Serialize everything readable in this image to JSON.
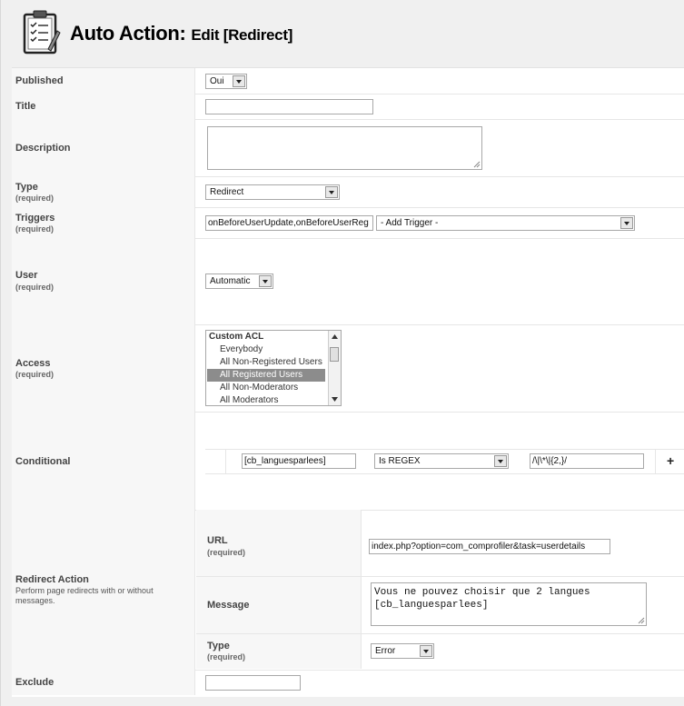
{
  "header": {
    "title_main": "Auto Action:",
    "title_sub": "Edit [Redirect]",
    "logo_icon": "notepad-checklist-icon"
  },
  "fields": {
    "published": {
      "label": "Published",
      "value": "Oui"
    },
    "title": {
      "label": "Title",
      "value": ""
    },
    "description": {
      "label": "Description",
      "value": ""
    },
    "type": {
      "label": "Type",
      "required": "(required)",
      "value": "Redirect"
    },
    "triggers": {
      "label": "Triggers",
      "required": "(required)",
      "value": "onBeforeUserUpdate,onBeforeUserReg",
      "add_trigger": "- Add Trigger -"
    },
    "user": {
      "label": "User",
      "required": "(required)",
      "value": "Automatic"
    },
    "access": {
      "label": "Access",
      "required": "(required)",
      "options": [
        "Custom ACL",
        "Everybody",
        "All Non-Registered Users",
        "All Registered Users",
        "All Non-Moderators",
        "All Moderators"
      ],
      "selected": "All Registered Users"
    },
    "conditional": {
      "label": "Conditional",
      "field": "[cb_languesparlees]",
      "operator": "Is REGEX",
      "value": "/\\|\\*\\|{2,}/",
      "add": "+"
    },
    "redirect": {
      "label": "Redirect Action",
      "description": "Perform page redirects with or without messages.",
      "url": {
        "label": "URL",
        "required": "(required)",
        "value": "index.php?option=com_comprofiler&task=userdetails"
      },
      "message": {
        "label": "Message",
        "line1": "Vous ne pouvez choisir que 2 langues",
        "line2": "[cb_languesparlees]"
      },
      "type": {
        "label": "Type",
        "required": "(required)",
        "value": "Error"
      }
    },
    "exclude": {
      "label": "Exclude",
      "value": ""
    }
  }
}
